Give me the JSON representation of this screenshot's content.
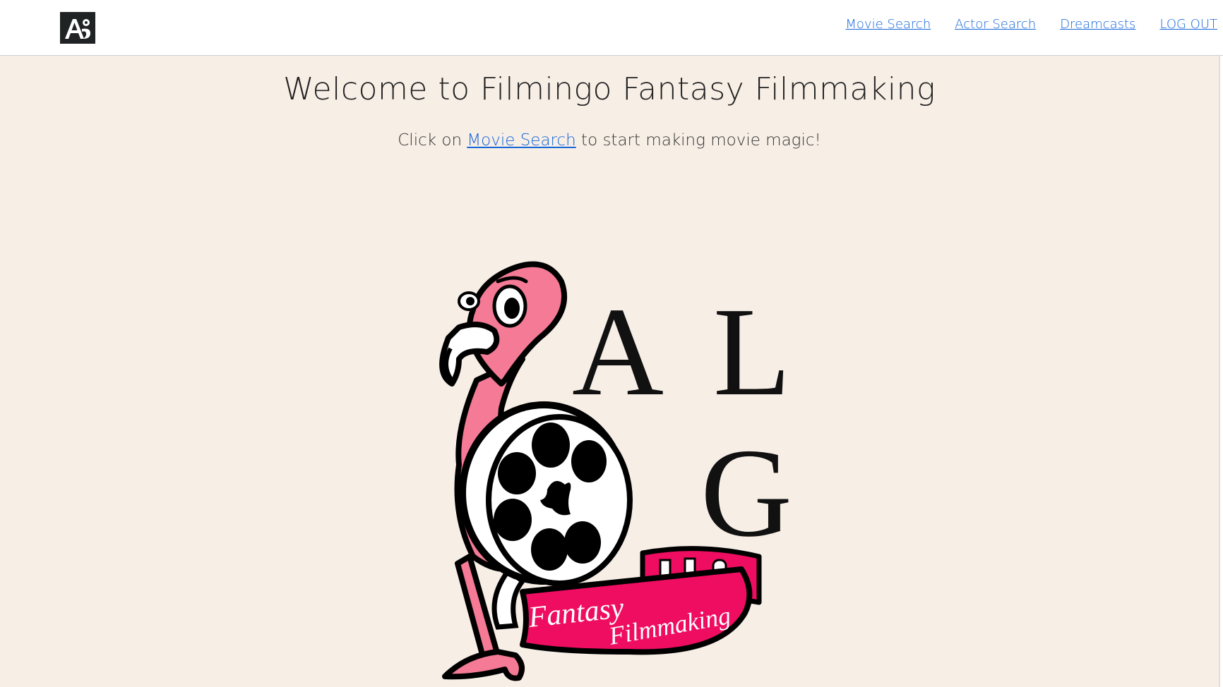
{
  "header": {
    "logo_icon": "alg-logo-icon",
    "nav": [
      {
        "label": "Movie Search"
      },
      {
        "label": "Actor Search"
      },
      {
        "label": "Dreamcasts"
      },
      {
        "label": "LOG OUT"
      }
    ]
  },
  "main": {
    "title": "Welcome to Filmingo Fantasy Filmmaking",
    "subtitle_prefix": "Click on ",
    "subtitle_link": "Movie Search",
    "subtitle_suffix": " to start making movie magic!",
    "logo_art": {
      "letters": [
        "A",
        "L",
        "G"
      ],
      "banner_text": [
        "Fantasy",
        "Filmmaking"
      ]
    }
  },
  "colors": {
    "link": "#1565d8",
    "background": "#f7eee6",
    "flamingo_pink": "#f47a95",
    "banner_pink": "#ee0d61",
    "logo_dark": "#1f2324"
  }
}
